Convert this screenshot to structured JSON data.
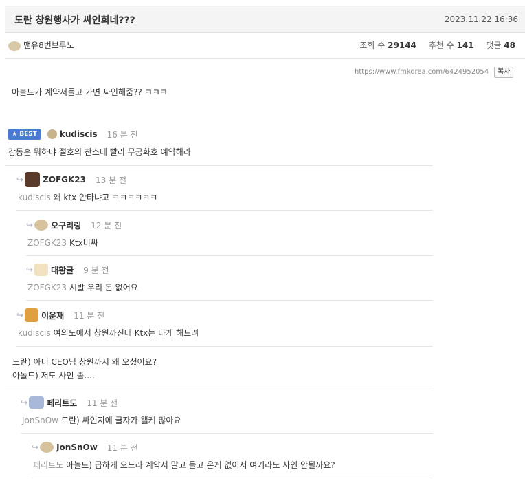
{
  "post": {
    "title": "도란 창원행사가 싸인회네???",
    "date": "2023.11.22 16:36",
    "author": "맨유8번브루노",
    "views_label": "조회 수",
    "views": "29144",
    "likes_label": "추천 수",
    "likes": "141",
    "comments_label": "댓글",
    "comments": "48",
    "url": "https://www.fmkorea.com/6424952054",
    "copy_label": "복사",
    "body": "아놀드가 계약서들고 가면 싸인해줌?? ㅋㅋㅋ"
  },
  "comments": [
    {
      "best": "BEST",
      "name": "kudiscis",
      "time": "16 분 전",
      "reply_to": "",
      "text": "강동훈 뭐하냐 절호의 찬스데 빨리 무궁화호 예약해라"
    },
    {
      "name": "ZOFGK23",
      "time": "13 분 전",
      "reply_to": "kudiscis",
      "text": "왜 ktx 안타냐고 ㅋㅋㅋㅋㅋㅋ"
    },
    {
      "name": "오구리링",
      "time": "12 분 전",
      "reply_to": "ZOFGK23",
      "text": "Ktx비싸"
    },
    {
      "name": "대황글",
      "time": "9 분 전",
      "reply_to": "ZOFGK23",
      "text": "시발 우리 돈 없어요"
    },
    {
      "name": "이운재",
      "time": "11 분 전",
      "reply_to": "kudiscis",
      "text": "여의도에서 창원까진데 Ktx는 타게 해드려"
    },
    {
      "name": "",
      "time": "",
      "reply_to": "",
      "text": "도란) 아니 CEO님 창원까지 왜 오셨어요?",
      "text2": "아놀드) 저도 사인 좀...."
    },
    {
      "name": "페리트도",
      "time": "11 분 전",
      "reply_to": "JonSnOw",
      "text": "도란) 싸인지에 글자가 왤케 많아요"
    },
    {
      "name": "JonSnOw",
      "time": "11 분 전",
      "reply_to": "페리트도",
      "text": "아놀드) 급하게 오느라 계약서 말고 들고 온게 없어서 여기라도 사인 안될까요?"
    }
  ]
}
